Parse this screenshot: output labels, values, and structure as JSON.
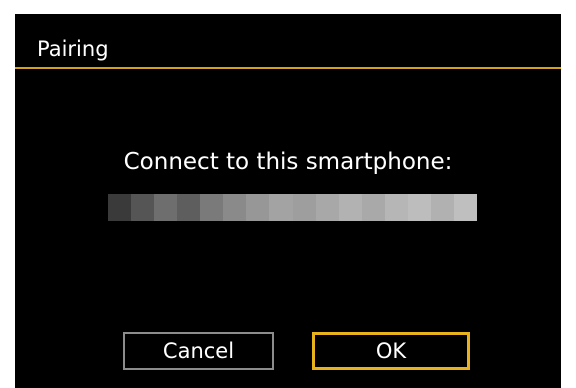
{
  "dialog": {
    "title": "Pairing",
    "message": "Connect to this smartphone:",
    "device_name_obscured": true
  },
  "buttons": {
    "cancel_label": "Cancel",
    "ok_label": "OK",
    "selected": "OK"
  },
  "colors": {
    "background": "#000000",
    "text": "#ffffff",
    "accent": "#e8b21c",
    "title_divider": "#d4a020",
    "cancel_border": "#8c8c8c"
  }
}
